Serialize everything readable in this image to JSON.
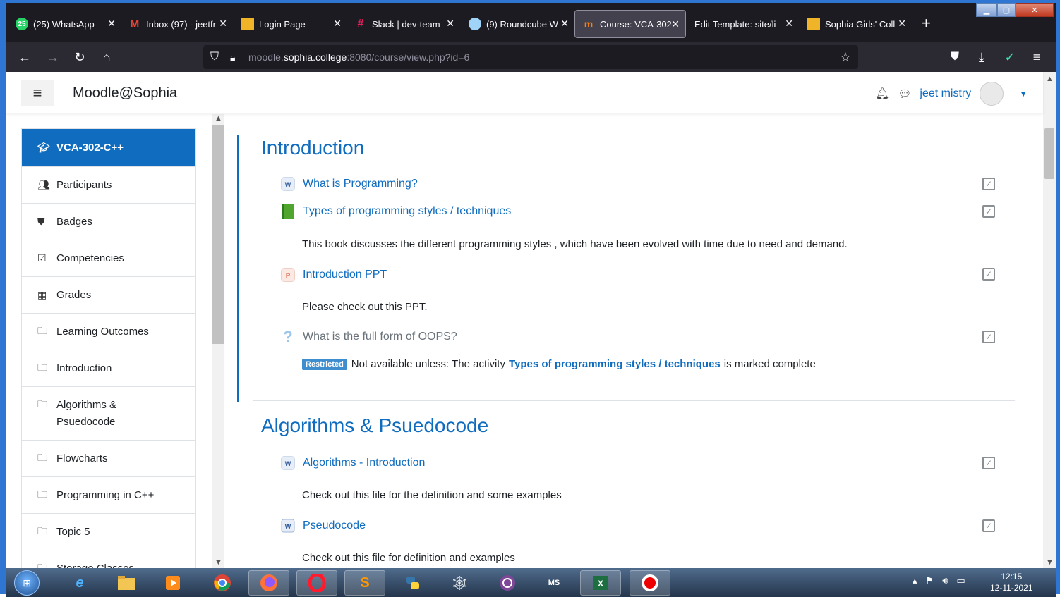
{
  "browser": {
    "tabs": [
      {
        "label": "(25) WhatsApp",
        "icon": "whatsapp-icon",
        "color": "#25d366"
      },
      {
        "label": "Inbox (97) - jeetfr",
        "icon": "gmail-icon",
        "color": "#ea4335"
      },
      {
        "label": "Login Page",
        "icon": "folder-icon",
        "color": "#f0b429"
      },
      {
        "label": "Slack | dev-team",
        "icon": "slack-icon",
        "color": "#e01e5a"
      },
      {
        "label": "(9) Roundcube W",
        "icon": "roundcube-icon",
        "color": "#3aa3e3"
      },
      {
        "label": "Course: VCA-302",
        "icon": "moodle-icon",
        "color": "#f98012",
        "active": true
      },
      {
        "label": "Edit Template: site/li",
        "icon": "",
        "color": ""
      },
      {
        "label": "Sophia Girls' Coll",
        "icon": "folder-icon",
        "color": "#f0b429"
      }
    ],
    "new_tab": "+",
    "url_host_prefix": "moodle.",
    "url_host": "sophia.college",
    "url_rest": ":8080/course/view.php?id=6"
  },
  "header": {
    "site_name": "Moodle@Sophia",
    "user_name": "jeet mistry"
  },
  "sidebar": {
    "items": [
      {
        "label": "VCA-302-C++",
        "icon": "graduation-cap-icon",
        "active": true
      },
      {
        "label": "Participants",
        "icon": "users-icon"
      },
      {
        "label": "Badges",
        "icon": "shield-icon"
      },
      {
        "label": "Competencies",
        "icon": "check-square-icon"
      },
      {
        "label": "Grades",
        "icon": "table-icon"
      },
      {
        "label": "Learning Outcomes",
        "icon": "folder-icon"
      },
      {
        "label": "Introduction",
        "icon": "folder-icon"
      },
      {
        "label": "Algorithms & Psuedocode",
        "icon": "folder-icon"
      },
      {
        "label": "Flowcharts",
        "icon": "folder-icon"
      },
      {
        "label": "Programming in C++",
        "icon": "folder-icon"
      },
      {
        "label": "Topic 5",
        "icon": "folder-icon"
      },
      {
        "label": "Storage Classes",
        "icon": "folder-icon"
      }
    ]
  },
  "sections": [
    {
      "title": "Introduction",
      "activities": [
        {
          "name": "What is Programming?",
          "icon": "word-doc-icon"
        },
        {
          "name": "Types of programming styles / techniques",
          "icon": "book-icon",
          "description": "This book discusses the different programming styles , which have been evolved with time due to need and demand."
        },
        {
          "name": "Introduction PPT",
          "icon": "powerpoint-icon",
          "description": "Please check out this PPT."
        },
        {
          "name": "What is the full form of OOPS?",
          "icon": "question-icon",
          "restricted": {
            "badge": "Restricted",
            "before": "Not available unless: The activity",
            "activity": "Types of programming styles / techniques",
            "after": "is marked complete"
          }
        }
      ]
    },
    {
      "title": "Algorithms & Psuedocode",
      "activities": [
        {
          "name": "Algorithms - Introduction",
          "icon": "word-doc-icon",
          "description": "Check out this file for the definition and some examples"
        },
        {
          "name": "Pseudocode",
          "icon": "word-doc-icon",
          "description": "Check out this file for definition and examples"
        }
      ]
    }
  ],
  "taskbar": {
    "apps": [
      "ie-icon",
      "file-explorer-icon",
      "media-player-icon",
      "chrome-icon",
      "firefox-icon",
      "opera-icon",
      "sublime-icon",
      "python-icon",
      "spider-icon",
      "tor-icon",
      "ms-project-icon",
      "excel-icon",
      "record-icon"
    ],
    "time": "12:15",
    "date": "12-11-2021"
  },
  "colors": {
    "accent": "#0f6cbf",
    "window_border": "#2f76d2"
  }
}
